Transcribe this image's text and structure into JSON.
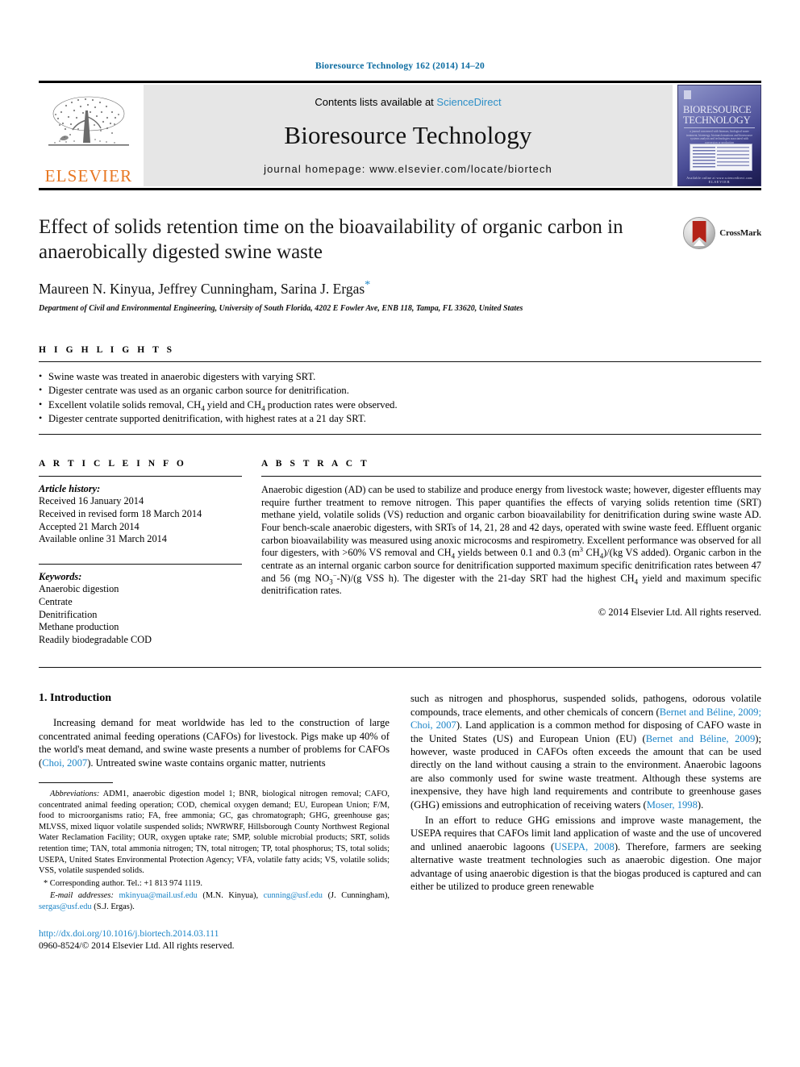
{
  "running_head": "Bioresource Technology 162 (2014) 14–20",
  "journal_header": {
    "contents_prefix": "Contents lists available at ",
    "sciencedirect": "ScienceDirect",
    "journal_title": "Bioresource Technology",
    "homepage": "journal homepage: www.elsevier.com/locate/biortech",
    "elsevier_wordmark": "ELSEVIER",
    "cover": {
      "title_line1": "BIORESOURCE",
      "title_line2": "TECHNOLOGY",
      "subtitle": "a journal concerned with biomass, biological waste treatment, bioenergy, biotransformations and bioresource systems analysis and technologies associated with conversion or production",
      "footer_small": "Available online at www.sciencedirect.com",
      "footer_brand": "ELSEVIER"
    }
  },
  "article": {
    "title": "Effect of solids retention time on the bioavailability of organic carbon in anaerobically digested swine waste",
    "authors": "Maureen N. Kinyua, Jeffrey Cunningham, Sarina J. Ergas",
    "author_star": "*",
    "affiliation": "Department of Civil and Environmental Engineering, University of South Florida, 4202 E Fowler Ave, ENB 118, Tampa, FL 33620, United States",
    "crossmark_label": "CrossMark"
  },
  "highlights": {
    "heading": "H I G H L I G H T S",
    "items": [
      "Swine waste was treated in anaerobic digesters with varying SRT.",
      "Digester centrate was used as an organic carbon source for denitrification.",
      "Excellent volatile solids removal, CH4 yield and CH4 production rates were observed.",
      "Digester centrate supported denitrification, with highest rates at a 21 day SRT."
    ]
  },
  "article_info": {
    "heading": "A R T I C L E   I N F O",
    "history_label": "Article history:",
    "history": [
      "Received 16 January 2014",
      "Received in revised form 18 March 2014",
      "Accepted 21 March 2014",
      "Available online 31 March 2014"
    ],
    "keywords_label": "Keywords:",
    "keywords": [
      "Anaerobic digestion",
      "Centrate",
      "Denitrification",
      "Methane production",
      "Readily biodegradable COD"
    ]
  },
  "abstract": {
    "heading": "A B S T R A C T",
    "text_part1": "Anaerobic digestion (AD) can be used to stabilize and produce energy from livestock waste; however, digester effluents may require further treatment to remove nitrogen. This paper quantifies the effects of varying solids retention time (SRT) methane yield, volatile solids (VS) reduction and organic carbon bioavailability for denitrification during swine waste AD. Four bench-scale anaerobic digesters, with SRTs of 14, 21, 28 and 42 days, operated with swine waste feed. Effluent organic carbon bioavailability was measured using anoxic microcosms and respirometry. Excellent performance was observed for all four digesters, with >60% VS removal and CH",
    "text_part2": " yields between 0.1 and 0.3 (m",
    "text_part3": " CH",
    "text_part4": ")/(kg VS added). Organic carbon in the centrate as an internal organic carbon source for denitrification supported maximum specific denitrification rates between 47 and 56 (mg NO",
    "text_part5": "-N)/(g VSS h). The digester with the 21-day SRT had the highest CH",
    "text_part6": " yield and maximum specific denitrification rates.",
    "copyright": "© 2014 Elsevier Ltd. All rights reserved."
  },
  "introduction": {
    "heading": "1. Introduction",
    "p1_a": "Increasing demand for meat worldwide has led to the construction of large concentrated animal feeding operations (CAFOs) for livestock. Pigs make up 40% of the world's meat demand, and swine waste presents a number of problems for CAFOs (",
    "p1_ref1": "Choi, 2007",
    "p1_b": "). Untreated swine waste contains organic matter, nutrients"
  },
  "right_column": {
    "p1_a": "such as nitrogen and phosphorus, suspended solids, pathogens, odorous volatile compounds, trace elements, and other chemicals of concern (",
    "p1_ref1": "Bernet and Béline, 2009; Choi, 2007",
    "p1_b": "). Land application is a common method for disposing of CAFO waste in the United States (US) and European Union (EU) (",
    "p1_ref2": "Bernet and Béline, 2009",
    "p1_c": "); however, waste produced in CAFOs often exceeds the amount that can be used directly on the land without causing a strain to the environment. Anaerobic lagoons are also commonly used for swine waste treatment. Although these systems are inexpensive, they have high land requirements and contribute to greenhouse gases (GHG) emissions and eutrophication of receiving waters (",
    "p1_ref3": "Moser, 1998",
    "p1_d": ").",
    "p2_a": "In an effort to reduce GHG emissions and improve waste management, the USEPA requires that CAFOs limit land application of waste and the use of uncovered and unlined anaerobic lagoons (",
    "p2_ref1": "USEPA, 2008",
    "p2_b": "). Therefore, farmers are seeking alternative waste treatment technologies such as anaerobic digestion. One major advantage of using anaerobic digestion is that the biogas produced is captured and can either be utilized to produce green renewable"
  },
  "footnotes": {
    "abbrev_label": "Abbreviations:",
    "abbrev_text": " ADM1, anaerobic digestion model 1; BNR, biological nitrogen removal; CAFO, concentrated animal feeding operation; COD, chemical oxygen demand; EU, European Union; F/M, food to microorganisms ratio; FA, free ammonia; GC, gas chromatograph; GHG, greenhouse gas; MLVSS, mixed liquor volatile suspended solids; NWRWRF, Hillsborough County Northwest Regional Water Reclamation Facility; OUR, oxygen uptake rate; SMP, soluble microbial products; SRT, solids retention time; TAN, total ammonia nitrogen; TN, total nitrogen; TP, total phosphorus; TS, total solids; USEPA, United States Environmental Protection Agency; VFA, volatile fatty acids; VS, volatile solids; VSS, volatile suspended solids.",
    "corresponding": "* Corresponding author. Tel.: +1 813 974 1119.",
    "email_label": "E-mail addresses:",
    "email1": "mkinyua@mail.usf.edu",
    "email1_name": " (M.N. Kinyua), ",
    "email2": "cunning@usf.edu",
    "email2_name": " (J. Cunningham), ",
    "email3": "sergas@usf.edu",
    "email3_name": " (S.J. Ergas).",
    "doi": "http://dx.doi.org/10.1016/j.biortech.2014.03.111",
    "issn": "0960-8524/© 2014 Elsevier Ltd. All rights reserved."
  }
}
